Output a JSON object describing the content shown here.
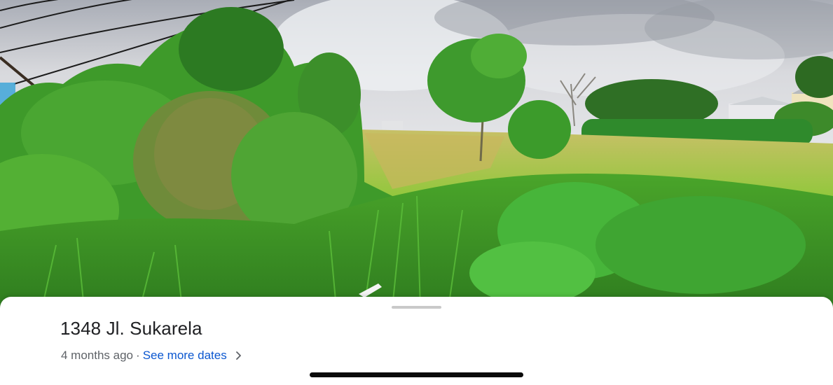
{
  "place": {
    "address": "1348 Jl. Sukarela",
    "capture_age": "4 months ago",
    "separator": "·",
    "more_dates_label": "See more dates"
  },
  "icons": {
    "more_dates": "chevron-right-icon"
  },
  "colors": {
    "link": "#0b57d0",
    "title": "#202124",
    "meta": "#5f6368",
    "sky": "#c9ccd2",
    "grass": "#57b82e"
  }
}
